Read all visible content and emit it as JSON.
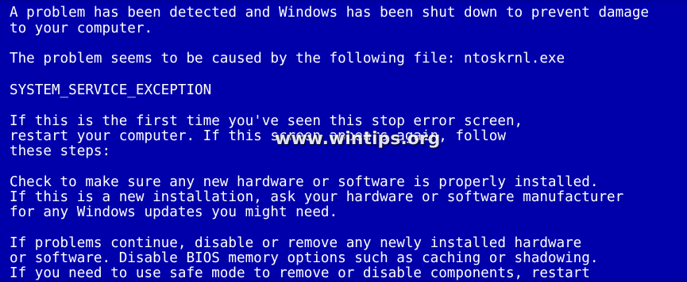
{
  "bsod": {
    "lines": [
      "A problem has been detected and Windows has been shut down to prevent damage",
      "to your computer.",
      "The problem seems to be caused by the following file: ntoskrnl.exe",
      "SYSTEM_SERVICE_EXCEPTION",
      "If this is the first time you've seen this stop error screen,",
      "restart your computer. If this screen appears again, follow",
      "these steps:",
      "Check to make sure any new hardware or software is properly installed.",
      "If this is a new installation, ask your hardware or software manufacturer",
      "for any Windows updates you might need.",
      "If problems continue, disable or remove any newly installed hardware",
      "or software. Disable BIOS memory options such as caching or shadowing.",
      "If you need to use safe mode to remove or disable components, restart"
    ],
    "watermark": "www.wintips.org",
    "colors": {
      "background": "#0000aa",
      "text": "#ffffff"
    }
  }
}
